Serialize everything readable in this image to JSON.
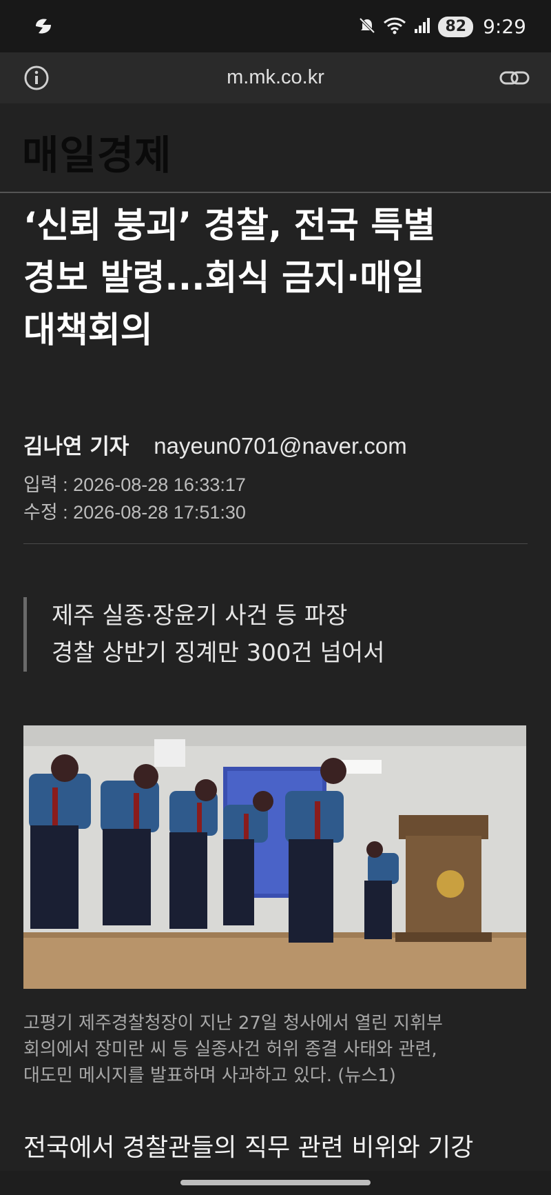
{
  "status_bar": {
    "time": "9:29",
    "battery": "82",
    "icons": [
      "flash-icon",
      "mute-icon",
      "wifi-icon",
      "signal-icon"
    ]
  },
  "browser": {
    "domain": "m.mk.co.kr",
    "icons": [
      "info-icon",
      "link-icon"
    ]
  },
  "site": {
    "brand": "매일경제"
  },
  "article": {
    "headline_lines": [
      "‘신뢰 붕괴’ 경찰, 전국 특별",
      "경보 발령...회식 금지·매일",
      "대책회의"
    ],
    "author": "김나연 기자",
    "email": "nayeun0701@naver.com",
    "input_time": "입력 : 2026-08-28 16:33:17",
    "modified_time": "수정 : 2026-08-28 17:51:30",
    "summary_lines": [
      "제주 실종·장윤기 사건 등 파장",
      "경찰 상반기 징계만 300건 넘어서"
    ],
    "caption_lines": [
      "고평기 제주경찰청장이 지난 27일 청사에서 열린 지휘부",
      "회의에서 장미란 씨 등 실종사건 허위 종결 사태와 관련,",
      "대도민 메시지를 발표하며 사과하고 있다. (뉴스1)"
    ],
    "body_start": "전국에서 경찰관들의 직무 관련 비위와 기강"
  },
  "colors": {
    "background": "#222222",
    "status_bar": "#181818",
    "url_bar": "#2a2a2a",
    "text": "#ffffff",
    "muted": "#a8a8a8"
  }
}
